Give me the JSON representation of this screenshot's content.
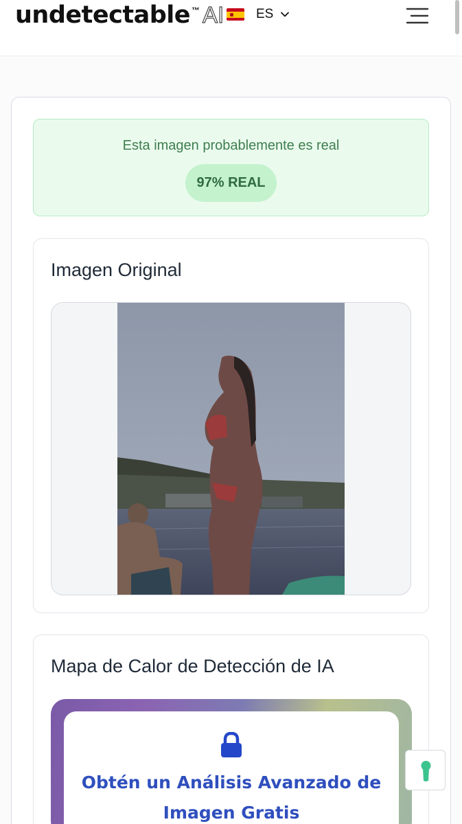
{
  "header": {
    "logo_word": "undetectable",
    "logo_tm": "™",
    "logo_ai": "AI",
    "language_code": "ES"
  },
  "result": {
    "message": "Esta imagen probablemente es real",
    "badge": "97% REAL"
  },
  "original_section": {
    "title": "Imagen Original"
  },
  "heatmap_section": {
    "title": "Mapa de Calor de Detección de IA",
    "promo_title": "Obtén un Análisis Avanzado de Imagen Gratis"
  },
  "colors": {
    "result_text": "#3f7d4f",
    "result_bg": "#eafbee",
    "badge_bg": "#c4f2cd",
    "promo_accent": "#2f4fbe"
  },
  "icons": [
    "spain-flag-icon",
    "chevron-down-icon",
    "hamburger-menu-icon",
    "lock-icon",
    "keyhole-icon"
  ]
}
